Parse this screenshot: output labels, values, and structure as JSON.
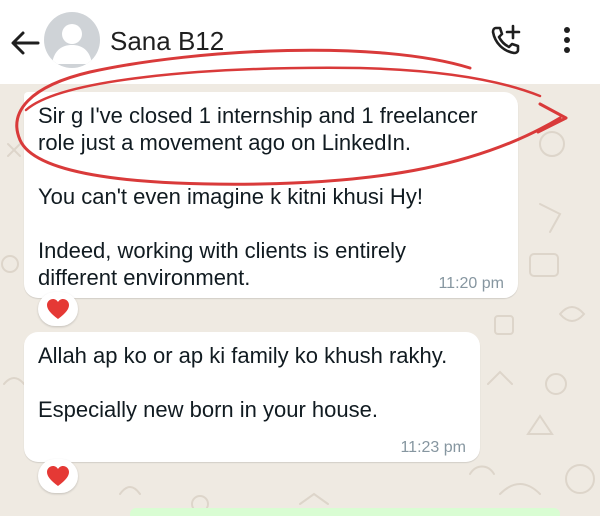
{
  "header": {
    "contact_name": "Sana B12"
  },
  "messages": [
    {
      "text": "Sir g I've closed 1 internship and 1 freelancer role just a movement ago on LinkedIn.\n\nYou can't even imagine k kitni khusi Hy!\n\nIndeed, working with clients is entirely\ndifferent environment.",
      "time": "11:20 pm",
      "reaction": "❤"
    },
    {
      "text": "Allah ap ko or ap ki family ko khush rakhy.\n\nEspecially new born in your house.",
      "time": "11:23 pm",
      "reaction": "❤"
    }
  ],
  "icons": {
    "back": "arrow-left-icon",
    "avatar": "default-avatar",
    "call": "add-call-icon",
    "menu": "more-vertical-icon",
    "reaction": "heart-icon"
  },
  "colors": {
    "chat_background": "#efeae2",
    "bubble": "#ffffff",
    "timestamp": "#8696a0",
    "annotation_red": "#d93a3a",
    "heart": "#e53935",
    "outgoing_bubble": "#d9fdd3"
  }
}
